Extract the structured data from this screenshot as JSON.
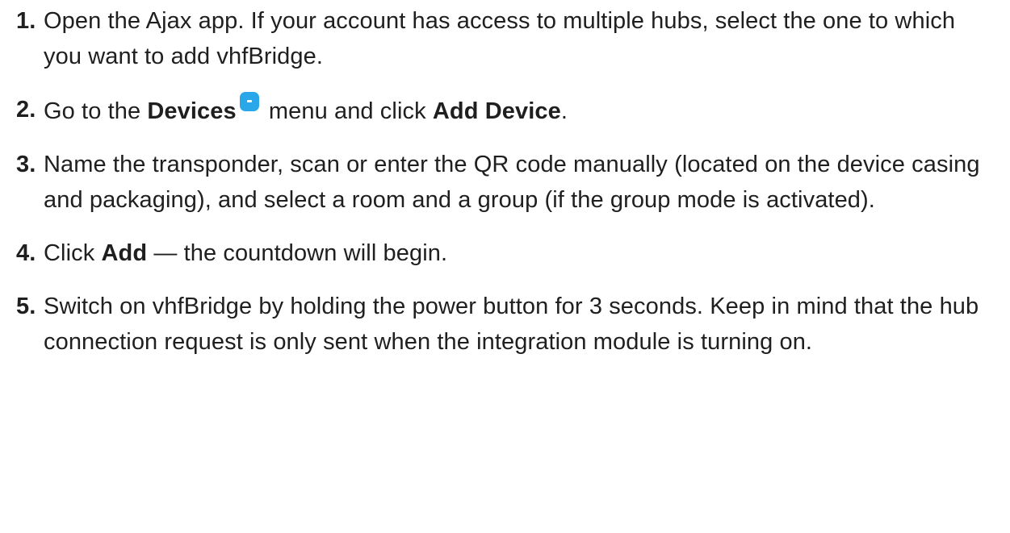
{
  "steps": [
    {
      "number": "1.",
      "text": "Open the Ajax app. If your account has access to multiple hubs, select the one to which you want to add vhfBridge."
    },
    {
      "number": "2.",
      "pre": "Go to the ",
      "bold1": "Devices",
      "icon": "devices-icon",
      "mid": " menu and click ",
      "bold2": "Add Device",
      "post": "."
    },
    {
      "number": "3.",
      "text": "Name the transponder, scan or enter the QR code manually (located on the device casing and packaging), and select a room and a group (if the group mode is activated)."
    },
    {
      "number": "4.",
      "pre": "Click ",
      "bold": "Add",
      "post": " — the countdown will begin."
    },
    {
      "number": "5.",
      "text": "Switch on vhfBridge by holding the power button for 3 seconds. Keep in mind that the hub connection request is only sent when the integration module is turning on."
    }
  ],
  "colors": {
    "text": "#1f1f1f",
    "icon_accent": "#2aa7e8"
  }
}
